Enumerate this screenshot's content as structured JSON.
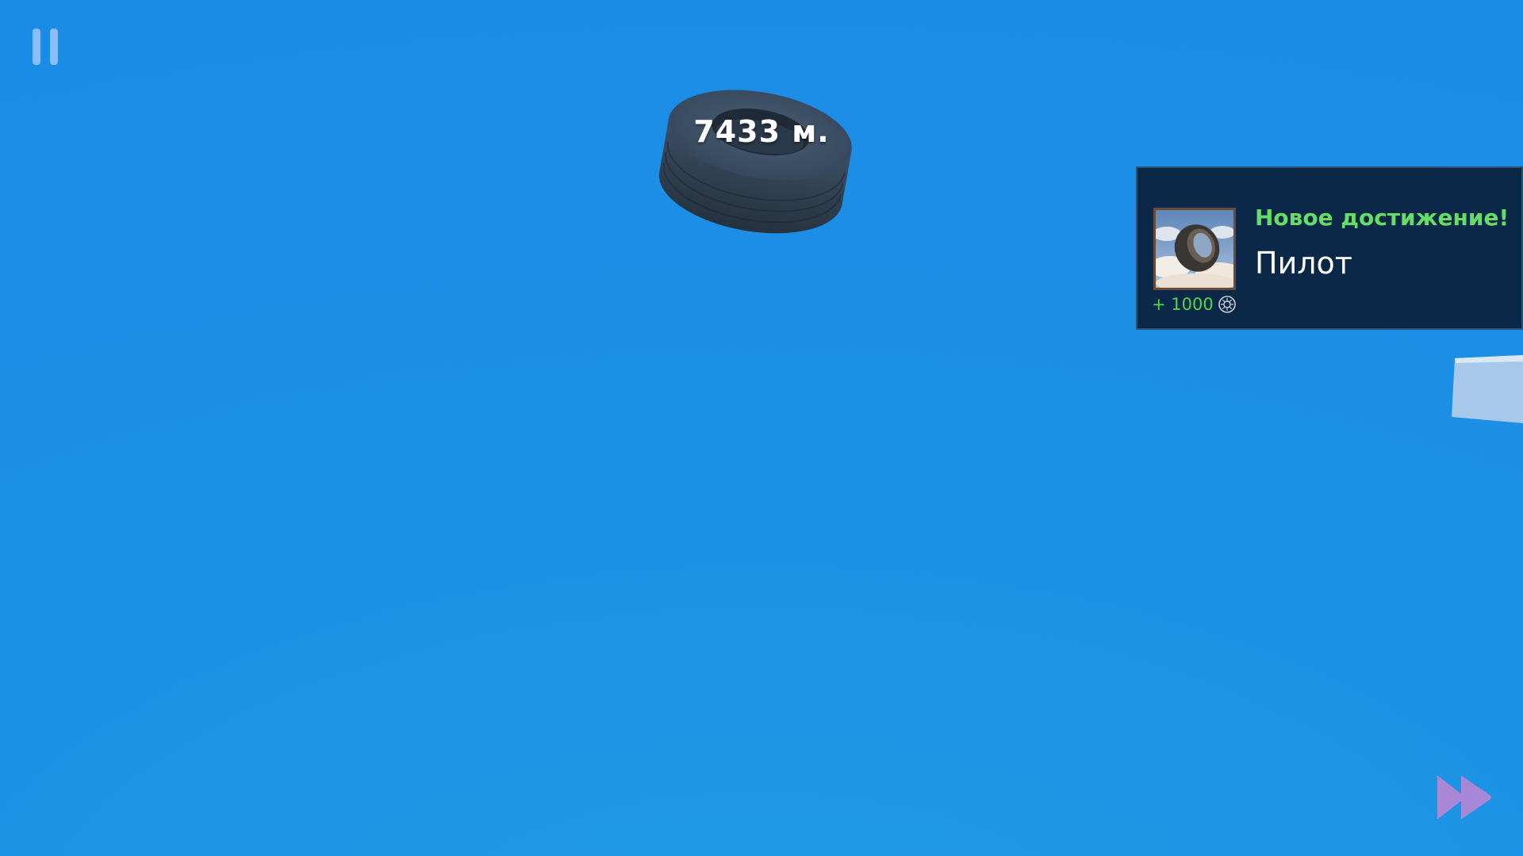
{
  "hud": {
    "pause_icon": "pause-icon",
    "fast_forward_icon": "fast-forward-icon",
    "distance": "7433 м."
  },
  "achievement": {
    "heading": "Новое достижение!",
    "name": "Пилот",
    "reward": "+ 1000",
    "reward_icon": "coin-icon",
    "image": "flying-tire-image"
  },
  "colors": {
    "sky": "#1c90e5",
    "toast_background": "#0b2848",
    "heading_green": "#66dd66",
    "reward_green": "#4dd84d",
    "pause_icon": "#9ec6ff",
    "fast_forward_icon": "#a887d6"
  }
}
